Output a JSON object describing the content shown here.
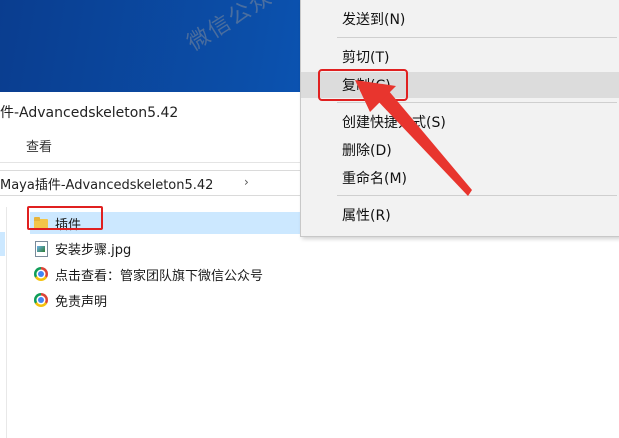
{
  "window": {
    "title": "件-Advancedskeleton5.42",
    "ribbon_tab": "查看",
    "address_path": "Maya插件-Advancedskeleton5.42",
    "address_chevron": "›"
  },
  "files": [
    {
      "name": "插件",
      "icon": "folder-icon",
      "selected": true
    },
    {
      "name": "安装步骤.jpg",
      "icon": "image-file-icon",
      "selected": false
    },
    {
      "name": "点击查看：管家团队旗下微信公众号",
      "icon": "chrome-icon",
      "selected": false
    },
    {
      "name": "免责声明",
      "icon": "chrome-icon",
      "selected": false
    }
  ],
  "context_menu": {
    "items": [
      {
        "label": "发送到(N)"
      },
      {
        "label": "剪切(T)"
      },
      {
        "label": "复制(C)",
        "hover": true
      },
      {
        "label": "创建快捷方式(S)"
      },
      {
        "label": "删除(D)"
      },
      {
        "label": "重命名(M)"
      },
      {
        "label": "属性(R)"
      }
    ]
  },
  "watermark": "微信公众号 插件",
  "colors": {
    "highlight_red": "#e02020",
    "selection_blue": "#cce8ff",
    "menu_bg": "#f2f2f2",
    "desktop_blue": "#0b4ea8"
  }
}
